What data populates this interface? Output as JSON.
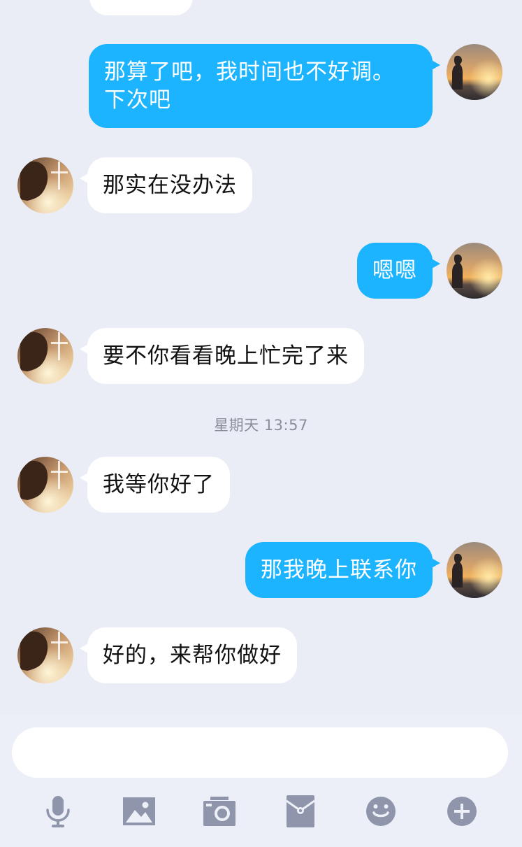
{
  "messages": [
    {
      "side": "out",
      "lines": [
        "那算了吧，我时间也不好调。",
        "下次吧"
      ]
    },
    {
      "side": "in",
      "text": "那实在没办法"
    },
    {
      "side": "out",
      "text": "嗯嗯"
    },
    {
      "side": "in",
      "text": "要不你看看晚上忙完了来"
    },
    {
      "side": "in",
      "text": "我等你好了"
    },
    {
      "side": "out",
      "text": "那我晚上联系你"
    },
    {
      "side": "in",
      "text": "好的，来帮你做好"
    }
  ],
  "timestamp": "星期天 13:57",
  "input": {
    "value": "",
    "placeholder": ""
  },
  "toolbar": [
    "microphone-icon",
    "image-icon",
    "camera-icon",
    "red-packet-icon",
    "emoji-icon",
    "plus-icon"
  ],
  "colors": {
    "outgoing_bubble": "#1cb4ff",
    "incoming_bubble": "#ffffff",
    "background": "#eaedf6",
    "icon": "#8f95ab"
  }
}
